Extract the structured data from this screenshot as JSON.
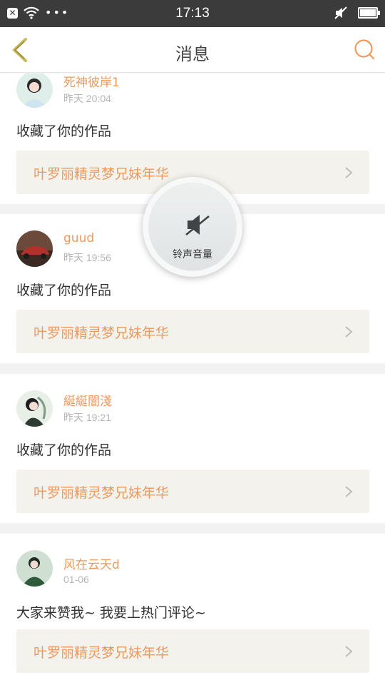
{
  "status_bar": {
    "time": "17:13",
    "dots": "•••"
  },
  "header": {
    "title": "消息"
  },
  "colors": {
    "accent": "#f0995c",
    "card_bg": "#ffffff",
    "work_bg": "#f3f2ed",
    "page_bg": "#f2f2f2"
  },
  "messages": [
    {
      "user": "死神彼岸1",
      "time": "昨天 20:04",
      "content": "收藏了你的作品",
      "work_title": "叶罗丽精灵梦兄妹年华"
    },
    {
      "user": "guud",
      "time": "昨天 19:56",
      "content": "收藏了你的作品",
      "work_title": "叶罗丽精灵梦兄妹年华"
    },
    {
      "user": "綖綖闇淺",
      "time": "昨天 19:21",
      "content": "收藏了你的作品",
      "work_title": "叶罗丽精灵梦兄妹年华"
    },
    {
      "user": "风在云天d",
      "time": "01-06",
      "content": "大家来赞我~ 我要上热门评论~",
      "work_title": "叶罗丽精灵梦兄妹年华"
    }
  ],
  "volume_overlay": {
    "label": "铃声音量"
  }
}
